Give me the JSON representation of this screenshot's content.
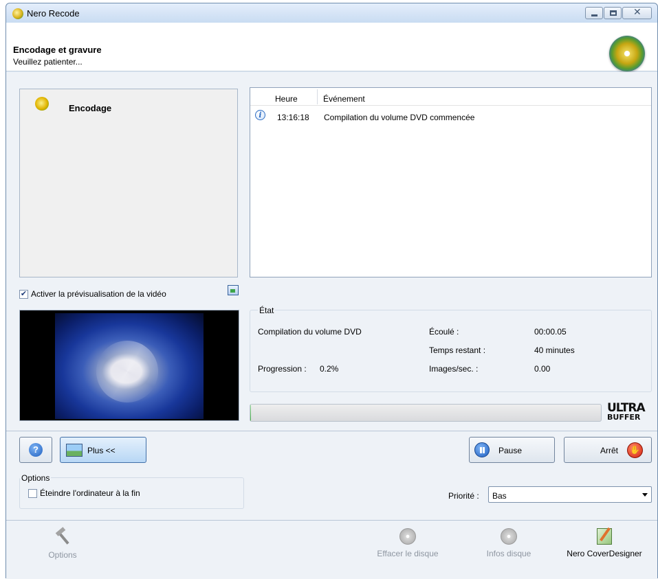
{
  "window": {
    "title": "Nero Recode"
  },
  "header": {
    "title": "Encodage et gravure",
    "subtitle": "Veuillez patienter..."
  },
  "left_panel": {
    "task_label": "Encodage"
  },
  "log": {
    "columns": [
      "Heure",
      "Événement"
    ],
    "rows": [
      {
        "time": "13:16:18",
        "event": "Compilation du volume DVD commencée",
        "icon": "info-icon"
      }
    ]
  },
  "preview": {
    "checkbox_label": "Activer la prévisualisation de la vidéo",
    "checked": true
  },
  "etat": {
    "legend": "État",
    "operation": "Compilation du volume DVD",
    "progress_label": "Progression :",
    "progress_value": "0.2%",
    "progress_fraction": 0.002,
    "stats": [
      {
        "label": "Écoulé :",
        "value": "00:00.05"
      },
      {
        "label": "Temps restant :",
        "value": "40 minutes"
      },
      {
        "label": "Images/sec. :",
        "value": "0.00"
      }
    ]
  },
  "branding": {
    "ultra_line1": "ULTRA",
    "ultra_line2": "BUFFER"
  },
  "buttons": {
    "help": "?",
    "more": "Plus <<",
    "pause": "Pause",
    "stop": "Arrêt"
  },
  "options": {
    "legend": "Options",
    "shutdown_label": "Éteindre l'ordinateur à la fin",
    "shutdown_checked": false
  },
  "priority": {
    "label": "Priorité :",
    "value": "Bas"
  },
  "toolbar": {
    "options": "Options",
    "erase_disc": "Effacer le disque",
    "disc_info": "Infos disque",
    "cover_designer": "Nero CoverDesigner"
  },
  "colors": {
    "accent": "#2d6cc2",
    "stop_red": "#d41f0b",
    "progress_green": "#43b043",
    "disabled_text": "#8e96a1"
  }
}
